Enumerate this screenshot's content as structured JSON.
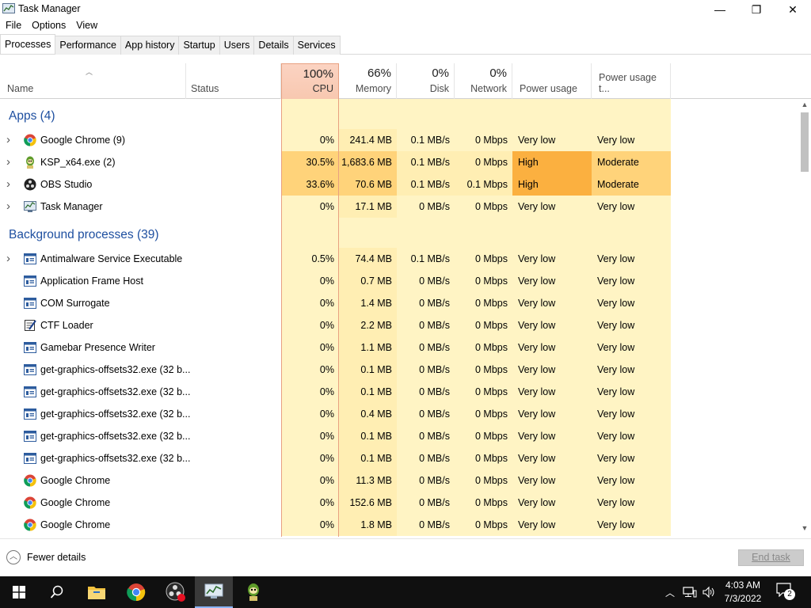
{
  "window": {
    "title": "Task Manager",
    "minimize": "—",
    "maximize": "❐",
    "close": "✕"
  },
  "menu": [
    "File",
    "Options",
    "View"
  ],
  "tabs": [
    {
      "label": "Processes",
      "active": true
    },
    {
      "label": "Performance",
      "active": false
    },
    {
      "label": "App history",
      "active": false
    },
    {
      "label": "Startup",
      "active": false
    },
    {
      "label": "Users",
      "active": false
    },
    {
      "label": "Details",
      "active": false
    },
    {
      "label": "Services",
      "active": false
    }
  ],
  "columns": {
    "name": {
      "label": "Name"
    },
    "status": {
      "label": "Status"
    },
    "cpu": {
      "percent": "100%",
      "label": "CPU"
    },
    "memory": {
      "percent": "66%",
      "label": "Memory"
    },
    "disk": {
      "percent": "0%",
      "label": "Disk"
    },
    "network": {
      "percent": "0%",
      "label": "Network"
    },
    "power": {
      "label": "Power usage"
    },
    "power_trend": {
      "label": "Power usage t..."
    }
  },
  "groups": [
    {
      "label": "Apps (4)",
      "rows": [
        {
          "name": "Google Chrome (9)",
          "icon": "chrome-icon",
          "expandable": true,
          "cpu": "0%",
          "memory": "241.4 MB",
          "disk": "0.1 MB/s",
          "network": "0 Mbps",
          "power": "Very low",
          "power_trend": "Very low",
          "heat": "low"
        },
        {
          "name": "KSP_x64.exe (2)",
          "icon": "ksp-icon",
          "expandable": true,
          "cpu": "30.5%",
          "memory": "1,683.6 MB",
          "disk": "0.1 MB/s",
          "network": "0 Mbps",
          "power": "High",
          "power_trend": "Moderate",
          "heat": "high"
        },
        {
          "name": "OBS Studio",
          "icon": "obs-icon",
          "expandable": true,
          "cpu": "33.6%",
          "memory": "70.6 MB",
          "disk": "0.1 MB/s",
          "network": "0.1 Mbps",
          "power": "High",
          "power_trend": "Moderate",
          "heat": "high"
        },
        {
          "name": "Task Manager",
          "icon": "task-manager-icon",
          "expandable": true,
          "cpu": "0%",
          "memory": "17.1 MB",
          "disk": "0 MB/s",
          "network": "0 Mbps",
          "power": "Very low",
          "power_trend": "Very low",
          "heat": "low"
        }
      ]
    },
    {
      "label": "Background processes (39)",
      "rows": [
        {
          "name": "Antimalware Service Executable",
          "icon": "window-icon",
          "expandable": true,
          "cpu": "0.5%",
          "memory": "74.4 MB",
          "disk": "0.1 MB/s",
          "network": "0 Mbps",
          "power": "Very low",
          "power_trend": "Very low",
          "heat": "low"
        },
        {
          "name": "Application Frame Host",
          "icon": "window-icon",
          "expandable": false,
          "cpu": "0%",
          "memory": "0.7 MB",
          "disk": "0 MB/s",
          "network": "0 Mbps",
          "power": "Very low",
          "power_trend": "Very low",
          "heat": "low"
        },
        {
          "name": "COM Surrogate",
          "icon": "window-icon",
          "expandable": false,
          "cpu": "0%",
          "memory": "1.4 MB",
          "disk": "0 MB/s",
          "network": "0 Mbps",
          "power": "Very low",
          "power_trend": "Very low",
          "heat": "low"
        },
        {
          "name": "CTF Loader",
          "icon": "ctf-loader-icon",
          "expandable": false,
          "cpu": "0%",
          "memory": "2.2 MB",
          "disk": "0 MB/s",
          "network": "0 Mbps",
          "power": "Very low",
          "power_trend": "Very low",
          "heat": "low"
        },
        {
          "name": "Gamebar Presence Writer",
          "icon": "window-icon",
          "expandable": false,
          "cpu": "0%",
          "memory": "1.1 MB",
          "disk": "0 MB/s",
          "network": "0 Mbps",
          "power": "Very low",
          "power_trend": "Very low",
          "heat": "low"
        },
        {
          "name": "get-graphics-offsets32.exe (32 b...",
          "icon": "window-icon",
          "expandable": false,
          "cpu": "0%",
          "memory": "0.1 MB",
          "disk": "0 MB/s",
          "network": "0 Mbps",
          "power": "Very low",
          "power_trend": "Very low",
          "heat": "low"
        },
        {
          "name": "get-graphics-offsets32.exe (32 b...",
          "icon": "window-icon",
          "expandable": false,
          "cpu": "0%",
          "memory": "0.1 MB",
          "disk": "0 MB/s",
          "network": "0 Mbps",
          "power": "Very low",
          "power_trend": "Very low",
          "heat": "low"
        },
        {
          "name": "get-graphics-offsets32.exe (32 b...",
          "icon": "window-icon",
          "expandable": false,
          "cpu": "0%",
          "memory": "0.4 MB",
          "disk": "0 MB/s",
          "network": "0 Mbps",
          "power": "Very low",
          "power_trend": "Very low",
          "heat": "low"
        },
        {
          "name": "get-graphics-offsets32.exe (32 b...",
          "icon": "window-icon",
          "expandable": false,
          "cpu": "0%",
          "memory": "0.1 MB",
          "disk": "0 MB/s",
          "network": "0 Mbps",
          "power": "Very low",
          "power_trend": "Very low",
          "heat": "low"
        },
        {
          "name": "get-graphics-offsets32.exe (32 b...",
          "icon": "window-icon",
          "expandable": false,
          "cpu": "0%",
          "memory": "0.1 MB",
          "disk": "0 MB/s",
          "network": "0 Mbps",
          "power": "Very low",
          "power_trend": "Very low",
          "heat": "low"
        },
        {
          "name": "Google Chrome",
          "icon": "chrome-icon",
          "expandable": false,
          "cpu": "0%",
          "memory": "11.3 MB",
          "disk": "0 MB/s",
          "network": "0 Mbps",
          "power": "Very low",
          "power_trend": "Very low",
          "heat": "low"
        },
        {
          "name": "Google Chrome",
          "icon": "chrome-icon",
          "expandable": false,
          "cpu": "0%",
          "memory": "152.6 MB",
          "disk": "0 MB/s",
          "network": "0 Mbps",
          "power": "Very low",
          "power_trend": "Very low",
          "heat": "low"
        },
        {
          "name": "Google Chrome",
          "icon": "chrome-icon",
          "expandable": false,
          "cpu": "0%",
          "memory": "1.8 MB",
          "disk": "0 MB/s",
          "network": "0 Mbps",
          "power": "Very low",
          "power_trend": "Very low",
          "heat": "low"
        }
      ]
    }
  ],
  "footer": {
    "fewer_details": "Fewer details",
    "end_task": "End task"
  },
  "taskbar": {
    "time": "4:03 AM",
    "date": "7/3/2022",
    "notification_count": "2"
  },
  "colors": {
    "group_label": "#1e4fa0",
    "heat_low": "#fff4c4",
    "heat_mid": "#ffd37a",
    "heat_high": "#fbb040",
    "cpu_header": "#f8c8b0"
  }
}
